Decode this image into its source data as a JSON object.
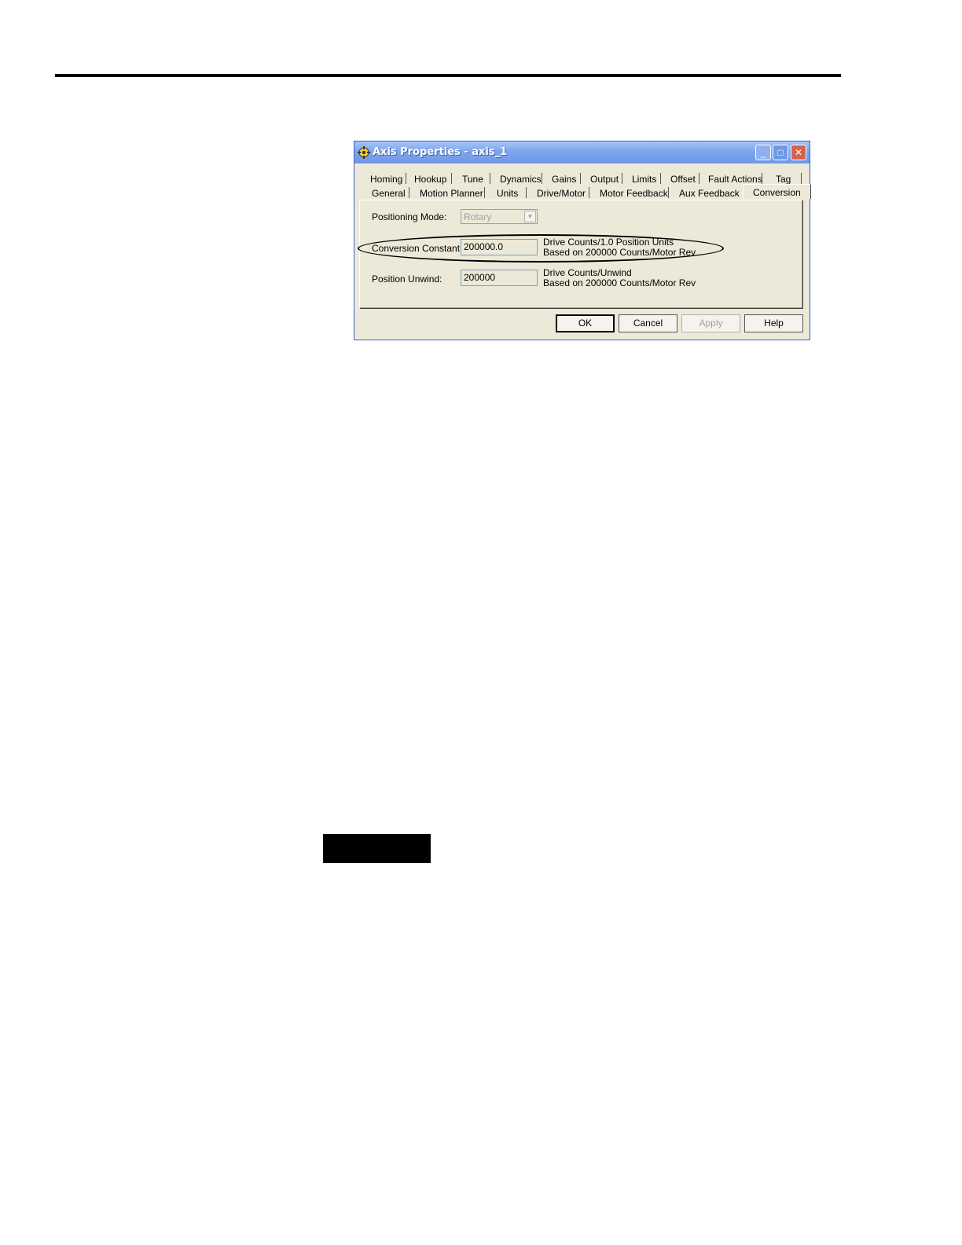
{
  "window": {
    "title": "Axis Properties - axis_1",
    "controls": {
      "minimize": "_",
      "maximize": "□",
      "close": "✕"
    }
  },
  "tabs_row1": [
    "Homing",
    "Hookup",
    "Tune",
    "Dynamics",
    "Gains",
    "Output",
    "Limits",
    "Offset",
    "Fault Actions",
    "Tag"
  ],
  "tabs_row2": [
    "General",
    "Motion Planner",
    "Units",
    "Drive/Motor",
    "Motor Feedback",
    "Aux Feedback",
    "Conversion"
  ],
  "active_tab": "Conversion",
  "form": {
    "positioning_mode_label": "Positioning Mode:",
    "positioning_mode_value": "Rotary",
    "conversion_constant_label": "Conversion Constant:",
    "conversion_constant_value": "200000.0",
    "conversion_desc_1": "Drive Counts/1.0 Position Units",
    "conversion_desc_2": "Based on 200000 Counts/Motor Rev",
    "position_unwind_label": "Position Unwind:",
    "position_unwind_value": "200000",
    "unwind_desc_1": "Drive Counts/Unwind",
    "unwind_desc_2": "Based on 200000 Counts/Motor Rev"
  },
  "buttons": {
    "ok": "OK",
    "cancel": "Cancel",
    "apply": "Apply",
    "help": "Help"
  },
  "colors": {
    "titlebar": "#7ea6ee",
    "dialog_bg": "#ece9d8",
    "close_button": "#d8634a"
  }
}
